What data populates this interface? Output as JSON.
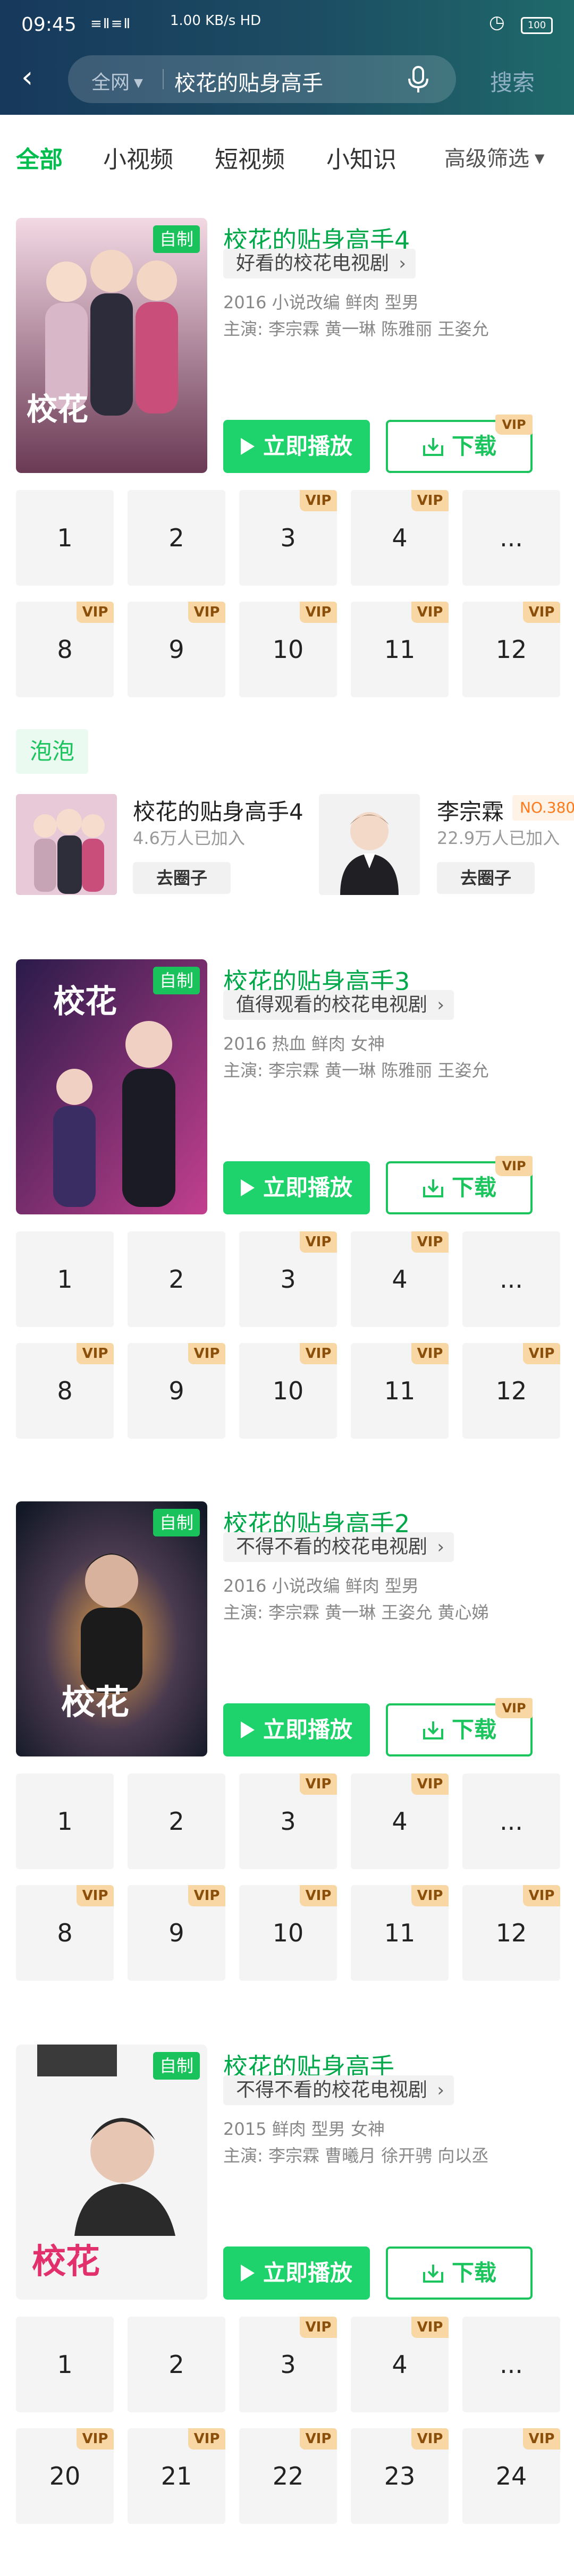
{
  "status": {
    "time": "09:45",
    "signal": "≡Ⅱ≡Ⅱ",
    "network": "1.00 KB/s HD",
    "battery": "100"
  },
  "search": {
    "scope": "全网",
    "query": "校花的贴身高手",
    "button": "搜索"
  },
  "tabs": [
    {
      "label": "全部"
    },
    {
      "label": "小视频"
    },
    {
      "label": "短视频"
    },
    {
      "label": "小知识"
    }
  ],
  "filter": {
    "label": "高级筛选"
  },
  "labels": {
    "self_made": "自制",
    "play": "立即播放",
    "download": "下载",
    "vip": "VIP",
    "more": "...",
    "join": "去圈子"
  },
  "cards": [
    {
      "title": "校花的贴身高手4",
      "tag": "好看的校花电视剧",
      "meta": "2016  小说改编  鲜肉  型男",
      "cast": "主演: 李宗霖  黄一琳  陈雅丽  王姿允",
      "row1": [
        "1",
        "2",
        "3",
        "4",
        "..."
      ],
      "row2": [
        "8",
        "9",
        "10",
        "11",
        "12"
      ]
    },
    {
      "title": "校花的贴身高手3",
      "tag": "值得观看的校花电视剧",
      "meta": "2016  热血  鲜肉  女神",
      "cast": "主演: 李宗霖  黄一琳  陈雅丽  王姿允",
      "row1": [
        "1",
        "2",
        "3",
        "4",
        "..."
      ],
      "row2": [
        "8",
        "9",
        "10",
        "11",
        "12"
      ]
    },
    {
      "title": "校花的贴身高手2",
      "tag": "不得不看的校花电视剧",
      "meta": "2016  小说改编  鲜肉  型男",
      "cast": "主演: 李宗霖  黄一琳  王姿允  黄心娣",
      "row1": [
        "1",
        "2",
        "3",
        "4",
        "..."
      ],
      "row2": [
        "8",
        "9",
        "10",
        "11",
        "12"
      ]
    },
    {
      "title": "校花的贴身高手",
      "tag": "不得不看的校花电视剧",
      "meta": "2015  鲜肉  型男  女神",
      "cast": "主演: 李宗霖  曹曦月  徐开骋  向以丞",
      "row1": [
        "1",
        "2",
        "3",
        "4",
        "..."
      ],
      "row2": [
        "20",
        "21",
        "22",
        "23",
        "24"
      ]
    }
  ],
  "paopao": {
    "label": "泡泡",
    "circles": [
      {
        "name": "校花的贴身高手4",
        "count": "4.6万人已加入"
      },
      {
        "name": "李宗霖",
        "count": "22.9万人已加入",
        "rank": "NO.380"
      }
    ]
  },
  "colors": {
    "accent": "#1cc45e",
    "title_green": "#00a84a",
    "vip_bg": "#f8d7a4",
    "vip_text": "#8a4f0b"
  }
}
